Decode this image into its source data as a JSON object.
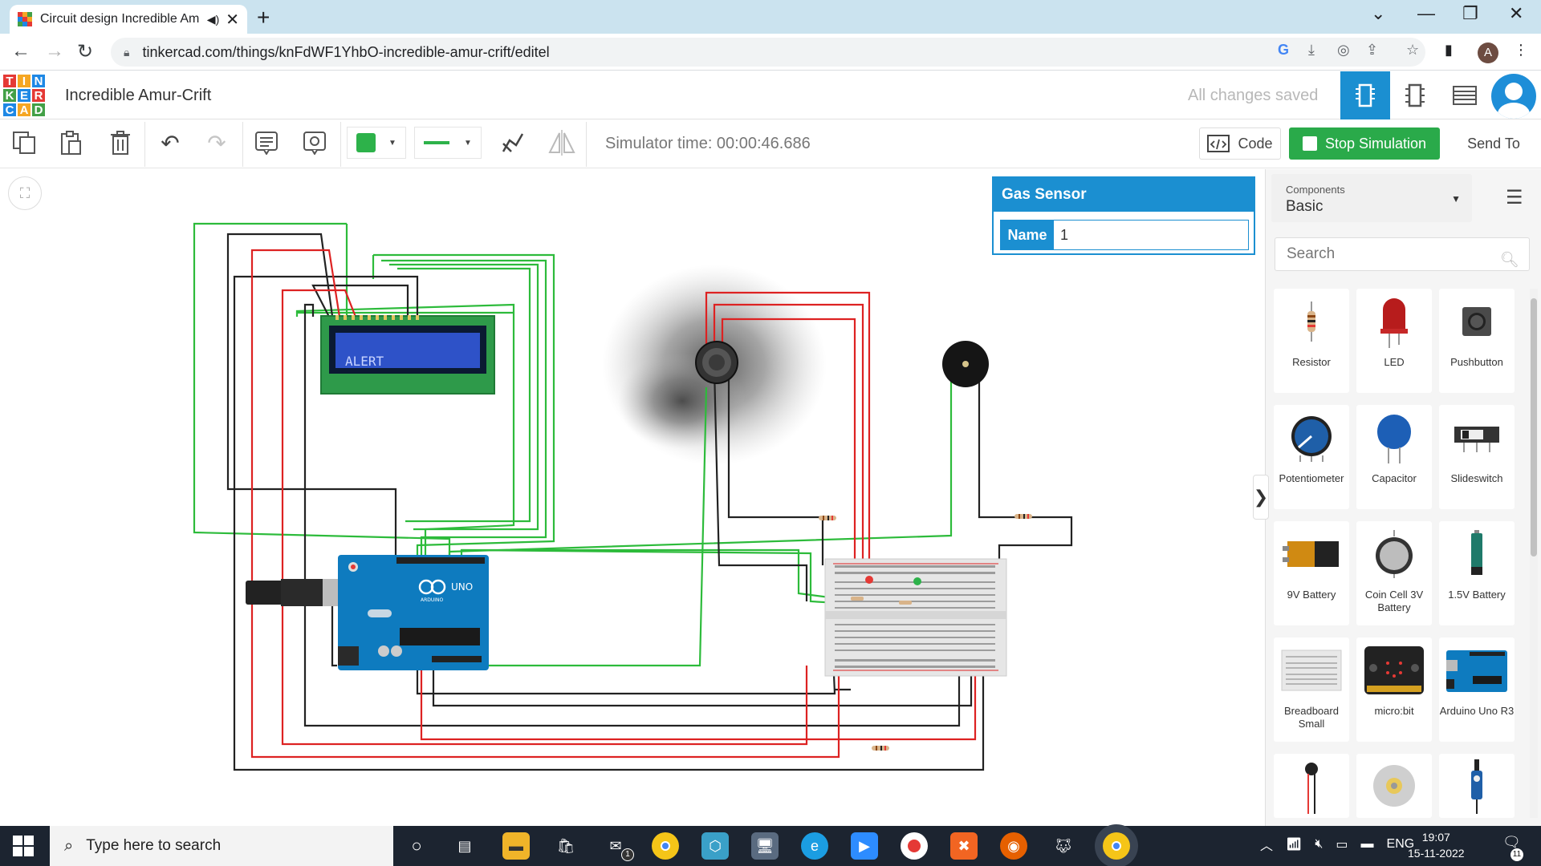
{
  "browser": {
    "tab_title": "Circuit design Incredible Am",
    "url": "tinkercad.com/things/knFdWF1YhbO-incredible-amur-crift/editel",
    "profile_initial": "A"
  },
  "app": {
    "logo_letters": [
      "T",
      "I",
      "N",
      "K",
      "E",
      "R",
      "C",
      "A",
      "D"
    ],
    "design_title": "Incredible Amur-Crift",
    "save_status": "All changes saved"
  },
  "toolbar": {
    "simulator_time": "Simulator time: 00:00:46.686",
    "code_label": "Code",
    "stop_label": "Stop Simulation",
    "send_label": "Send To",
    "color_swatch": "#2db24a"
  },
  "inspector": {
    "title": "Gas Sensor",
    "name_label": "Name",
    "name_value": "1"
  },
  "panel": {
    "select_caption": "Components",
    "select_value": "Basic",
    "search_placeholder": "Search",
    "components": [
      {
        "label": "Resistor",
        "icon": "resistor-icon"
      },
      {
        "label": "LED",
        "icon": "led-icon"
      },
      {
        "label": "Pushbutton",
        "icon": "pushbutton-icon"
      },
      {
        "label": "Potentiometer",
        "icon": "potentiometer-icon"
      },
      {
        "label": "Capacitor",
        "icon": "capacitor-icon"
      },
      {
        "label": "Slideswitch",
        "icon": "slideswitch-icon"
      },
      {
        "label": "9V Battery",
        "icon": "battery-9v-icon"
      },
      {
        "label": "Coin Cell 3V Battery",
        "icon": "coin-cell-icon"
      },
      {
        "label": "1.5V Battery",
        "icon": "battery-aa-icon"
      },
      {
        "label": "Breadboard Small",
        "icon": "breadboard-icon"
      },
      {
        "label": "micro:bit",
        "icon": "microbit-icon"
      },
      {
        "label": "Arduino Uno R3",
        "icon": "arduino-icon"
      }
    ]
  },
  "circuit": {
    "lcd_text": "ALERT",
    "arduino_label": "UNO",
    "arduino_brand": "ARDUINO"
  },
  "taskbar": {
    "search_placeholder": "Type here to search",
    "language": "ENG",
    "time": "19:07",
    "date": "15-11-2022",
    "notification_count": "11",
    "mail_badge": "1"
  }
}
